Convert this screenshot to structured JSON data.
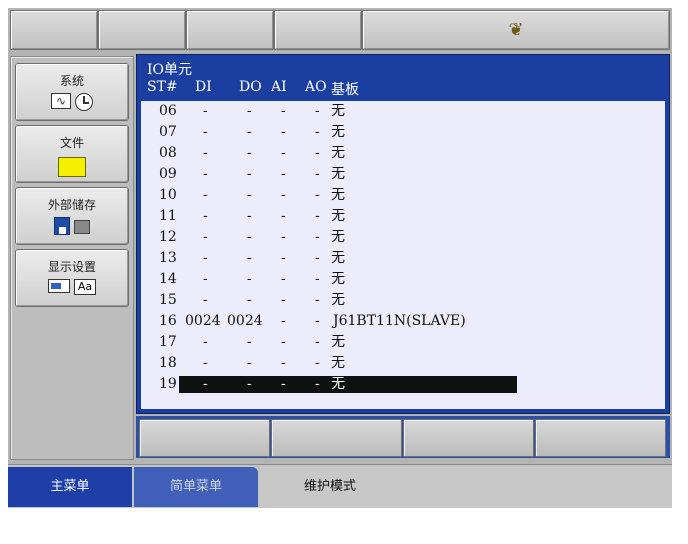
{
  "top_tabs": [
    {
      "label": ""
    },
    {
      "label": ""
    },
    {
      "label": ""
    },
    {
      "label": ""
    },
    {
      "icon": "yaskawa-logo-icon"
    }
  ],
  "main_menu": [
    {
      "label": "系统",
      "icons": [
        "waveform-icon",
        "clock-icon"
      ]
    },
    {
      "label": "文件",
      "icons": [
        "folder-icon"
      ]
    },
    {
      "label": "外部储存",
      "icons": [
        "floppy-disk-icon",
        "memory-card-icon"
      ]
    },
    {
      "label": "显示设置",
      "icons": [
        "screen-icon",
        "font-aa-icon"
      ]
    }
  ],
  "panel": {
    "title": "IO单元",
    "columns": {
      "st": "ST#",
      "di": "DI",
      "do": "DO",
      "ai": "AI",
      "ao": "AO",
      "board": "基板"
    },
    "rows": [
      {
        "st": "06",
        "di": "-",
        "do": "-",
        "ai": "-",
        "ao": "-",
        "board": "无"
      },
      {
        "st": "07",
        "di": "-",
        "do": "-",
        "ai": "-",
        "ao": "-",
        "board": "无"
      },
      {
        "st": "08",
        "di": "-",
        "do": "-",
        "ai": "-",
        "ao": "-",
        "board": "无"
      },
      {
        "st": "09",
        "di": "-",
        "do": "-",
        "ai": "-",
        "ao": "-",
        "board": "无"
      },
      {
        "st": "10",
        "di": "-",
        "do": "-",
        "ai": "-",
        "ao": "-",
        "board": "无"
      },
      {
        "st": "11",
        "di": "-",
        "do": "-",
        "ai": "-",
        "ao": "-",
        "board": "无"
      },
      {
        "st": "12",
        "di": "-",
        "do": "-",
        "ai": "-",
        "ao": "-",
        "board": "无"
      },
      {
        "st": "13",
        "di": "-",
        "do": "-",
        "ai": "-",
        "ao": "-",
        "board": "无"
      },
      {
        "st": "14",
        "di": "-",
        "do": "-",
        "ai": "-",
        "ao": "-",
        "board": "无"
      },
      {
        "st": "15",
        "di": "-",
        "do": "-",
        "ai": "-",
        "ao": "-",
        "board": "无"
      },
      {
        "st": "16",
        "di": "0024",
        "do": "0024",
        "ai": "-",
        "ao": "-",
        "board": "J61BT11N(SLAVE)"
      },
      {
        "st": "17",
        "di": "-",
        "do": "-",
        "ai": "-",
        "ao": "-",
        "board": "无"
      },
      {
        "st": "18",
        "di": "-",
        "do": "-",
        "ai": "-",
        "ao": "-",
        "board": "无"
      },
      {
        "st": "19",
        "di": "-",
        "do": "-",
        "ai": "-",
        "ao": "-",
        "board": "无",
        "selected": true
      }
    ]
  },
  "soft_keys": [
    {
      "label": ""
    },
    {
      "label": ""
    },
    {
      "label": ""
    },
    {
      "label": ""
    }
  ],
  "bottom_tabs": [
    {
      "label": "主菜单",
      "active": true
    },
    {
      "label": "简单菜单"
    },
    {
      "label": "维护模式"
    }
  ],
  "colors": {
    "active_tab": "#1f3fa8",
    "panel_blue": "#1a3fa0",
    "list_bg": "#ececfa",
    "selection": "#111111"
  }
}
